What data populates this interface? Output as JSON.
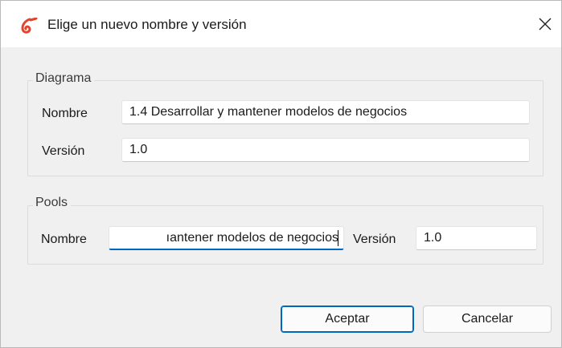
{
  "window": {
    "title": "Elige un nuevo nombre y versión",
    "app_icon": "bonita-logo-icon",
    "close_icon": "close-icon"
  },
  "diagram": {
    "legend": "Diagrama",
    "name_label": "Nombre",
    "name_value": "1.4 Desarrollar y mantener modelos de negocios",
    "version_label": "Versión",
    "version_value": "1.0"
  },
  "pools": {
    "legend": "Pools",
    "name_label": "Nombre",
    "name_visible_text": "ıantener modelos de negocios",
    "version_label": "Versión",
    "version_value": "1.0"
  },
  "buttons": {
    "accept_label": "Aceptar",
    "cancel_label": "Cancelar"
  },
  "colors": {
    "accent": "#0067c0",
    "brand_icon": "#e8402a",
    "dialog_bg": "#f0f0f0"
  }
}
